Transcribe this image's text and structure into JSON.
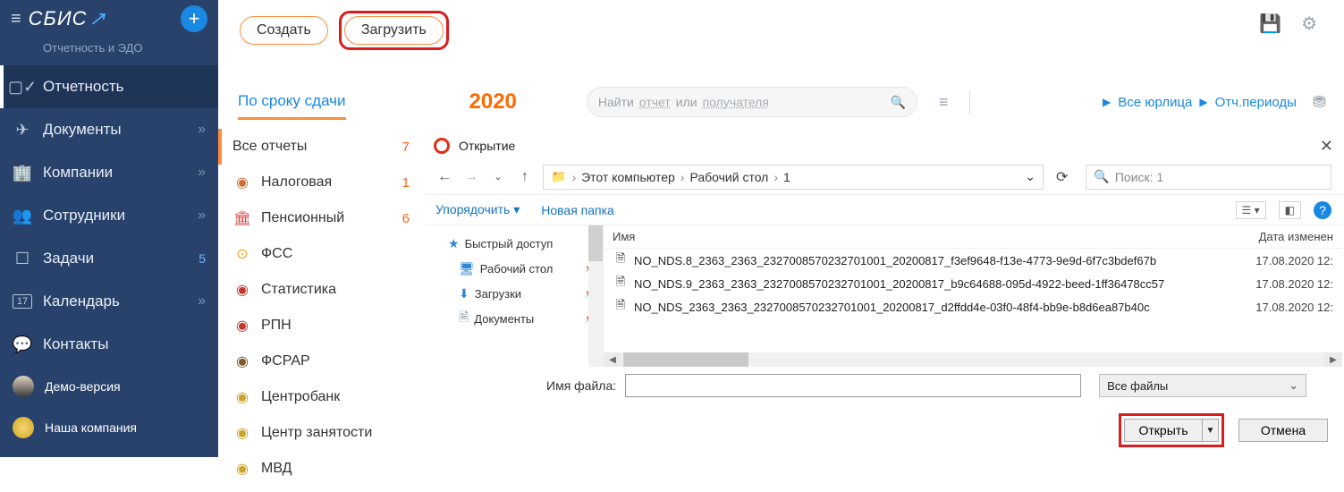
{
  "brand": {
    "name": "СБИС",
    "subtitle": "Отчетность и ЭДО"
  },
  "sidebar": {
    "items": [
      {
        "label": "Отчетность"
      },
      {
        "label": "Документы"
      },
      {
        "label": "Компании"
      },
      {
        "label": "Сотрудники"
      },
      {
        "label": "Задачи",
        "count": "5"
      },
      {
        "label": "Календарь",
        "badge": "17"
      },
      {
        "label": "Контакты"
      }
    ],
    "user": "Демо-версия",
    "org": "Наша компания"
  },
  "buttons": {
    "create": "Создать",
    "upload": "Загрузить"
  },
  "tab": {
    "deadline": "По сроку сдачи"
  },
  "year": "2020",
  "search": {
    "find": "Найти",
    "report": "отчет",
    "or": "или",
    "receiver": "получателя"
  },
  "filters": {
    "all_entities": "Все юрлица",
    "periods": "Отч.периоды"
  },
  "categories": [
    {
      "label": "Все отчеты",
      "count": "7",
      "count_color": "orange"
    },
    {
      "label": "Налоговая",
      "count": "1",
      "count_color": "orange",
      "icon_color": "#c96e36"
    },
    {
      "label": "Пенсионный",
      "count": "6",
      "count_color": "orange",
      "icon_color": "#d44"
    },
    {
      "label": "ФСС",
      "icon_color": "#f5a61d"
    },
    {
      "label": "Статистика",
      "icon_color": "#c0392b"
    },
    {
      "label": "РПН",
      "icon_color": "#c0392b"
    },
    {
      "label": "ФСРАР",
      "icon_color": "#7c5a2a"
    },
    {
      "label": "Центробанк",
      "icon_color": "#c9a227"
    },
    {
      "label": "Центр занятости",
      "icon_color": "#c9a227"
    },
    {
      "label": "МВД",
      "icon_color": "#c9a227"
    }
  ],
  "dialog": {
    "title": "Открытие",
    "breadcrumb": [
      "Этот компьютер",
      "Рабочий стол",
      "1"
    ],
    "search_placeholder": "Поиск: 1",
    "toolbar": {
      "organize": "Упорядочить",
      "new_folder": "Новая папка"
    },
    "tree": [
      {
        "label": "Быстрый доступ"
      },
      {
        "label": "Рабочий стол",
        "pin": true
      },
      {
        "label": "Загрузки",
        "pin": true
      },
      {
        "label": "Документы",
        "pin": true
      }
    ],
    "columns": {
      "name": "Имя",
      "date": "Дата изменен"
    },
    "files": [
      {
        "name": "NO_NDS.8_2363_2363_2327008570232701001_20200817_f3ef9648-f13e-4773-9e9d-6f7c3bdef67b",
        "date": "17.08.2020 12:"
      },
      {
        "name": "NO_NDS.9_2363_2363_2327008570232701001_20200817_b9c64688-095d-4922-beed-1ff36478cc57",
        "date": "17.08.2020 12:"
      },
      {
        "name": "NO_NDS_2363_2363_2327008570232701001_20200817_d2ffdd4e-03f0-48f4-bb9e-b8d6ea87b40c",
        "date": "17.08.2020 12:"
      }
    ],
    "filename_label": "Имя файла:",
    "filetype": "Все файлы",
    "open": "Открыть",
    "cancel": "Отмена"
  }
}
